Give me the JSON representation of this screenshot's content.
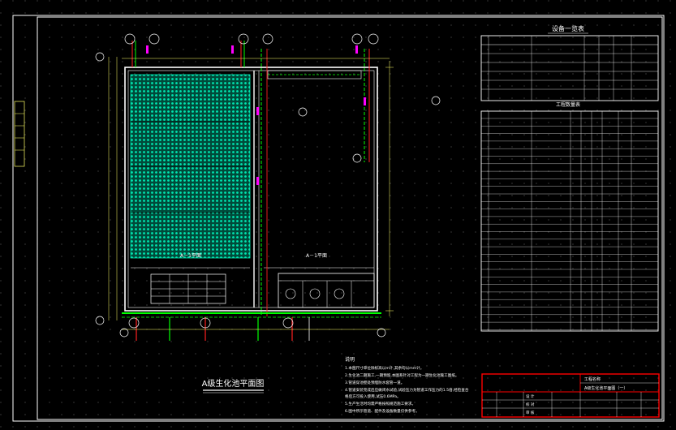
{
  "drawing": {
    "title": "A级生化池平面图",
    "table1_title": "设备一览表",
    "table2_title": "工程数量表",
    "left_label": "A－1平面",
    "right_label": "A－1平面",
    "notes_title": "说明",
    "notes": [
      "1.本图尺寸单位除标高以m计,其余均以mm计。",
      "2.生化池二期施工,一期预留,本图系针对工程为一期生化池施工图纸。",
      "3.管道穿池壁处预埋防水套管一道。",
      "4.管道安装完成后应做闭水试验,试验压力为管道工作压力的1.5倍,经检查合",
      "  格后方可投入使用,试压0.6MPa。",
      "5.生产生活时均需严格按照规范施工要求。",
      "6.图中所示管道、配件及设备数量仅供参考。"
    ],
    "title_block": {
      "project": "工程名称",
      "drawing_name": "A级生化池平面图（一）",
      "rows": [
        "设 计",
        "校 对",
        "审 核"
      ]
    }
  },
  "colors": {
    "background": "#000000",
    "border": "#ffffff",
    "walls": "#ffffff",
    "diffuser_grid": "#00e5b0",
    "pipe_green": "#00ff00",
    "pipe_red": "#ff2020",
    "magenta": "#ff00ff",
    "title_block_frame": "#ff0000",
    "dim_text": "#ffff66"
  }
}
